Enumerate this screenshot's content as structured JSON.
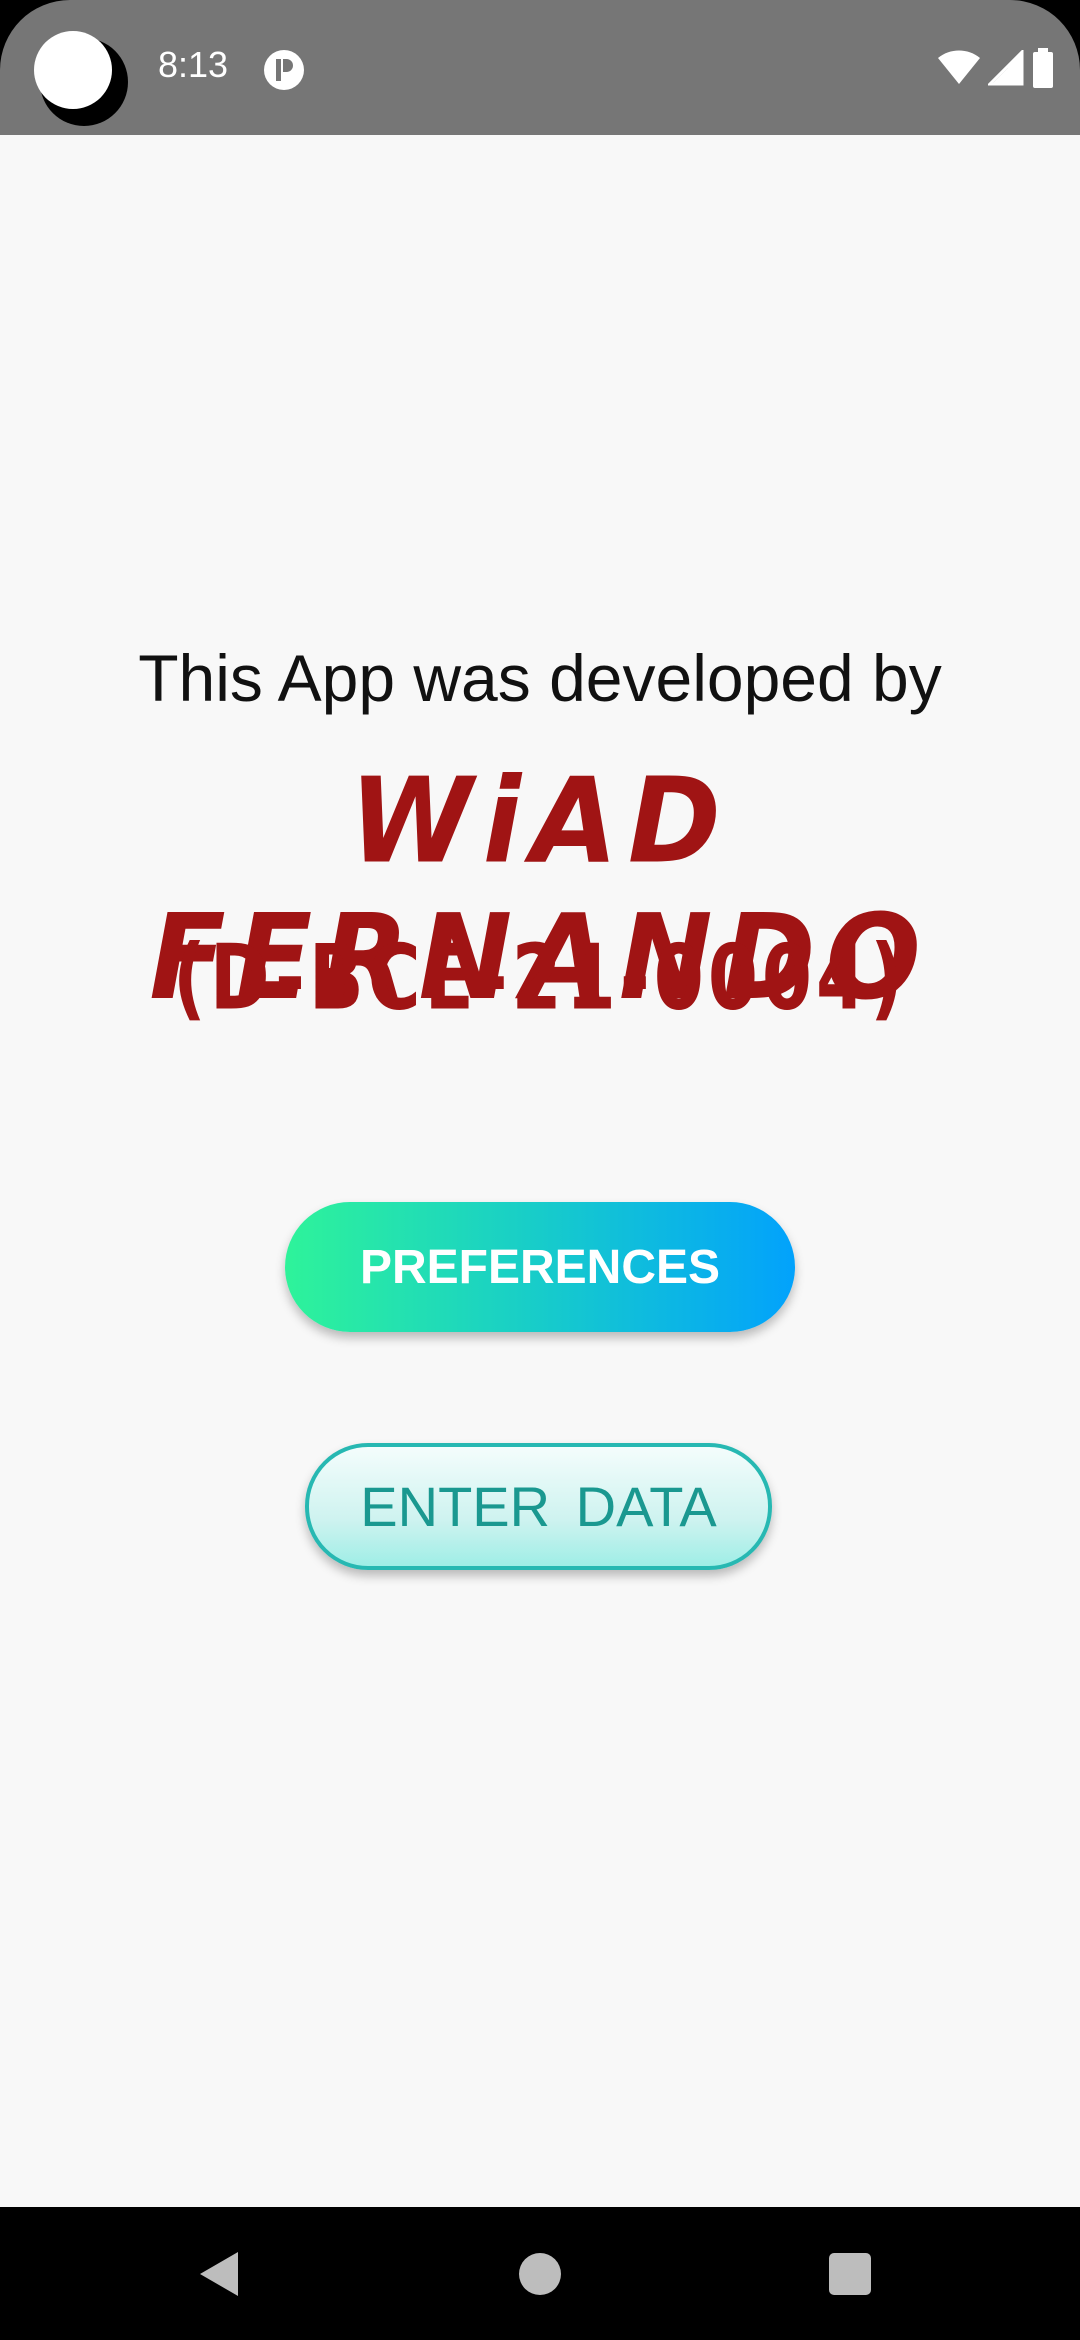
{
  "status_bar": {
    "time": "8:13",
    "icons": [
      "camera-cutout",
      "notification-icon",
      "wifi-icon",
      "cell-signal-icon",
      "battery-icon"
    ],
    "background_color": "#767676"
  },
  "main": {
    "intro": "This App was developed by",
    "developer_name": "WiAD FERNANDO",
    "developer_id": "(D-BCE-21-0004)",
    "text_accent_color": "#a01414"
  },
  "buttons": {
    "preferences_label": "PREFERENCES",
    "enter_data_label": "ENTER  DATA",
    "preferences_gradient": [
      "#2ef39a",
      "#02a2fc"
    ],
    "enter_data_border_color": "#27b8b2"
  },
  "nav_bar": {
    "icons": [
      "back-icon",
      "home-icon",
      "recents-icon"
    ]
  }
}
